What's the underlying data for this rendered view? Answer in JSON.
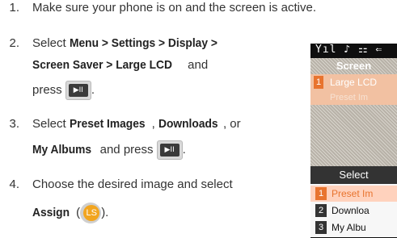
{
  "steps": [
    {
      "num": "1.",
      "text": "Make sure your phone is on and the screen is active."
    },
    {
      "num": "2.",
      "pre": "Select ",
      "path": "Menu > Settings > Display >",
      "path2": "Screen Saver > Large LCD",
      "post": " and",
      "press": "press"
    },
    {
      "num": "3.",
      "pre": "Select ",
      "a": "Preset Images",
      "sep1": ", ",
      "b": "Downloads",
      "sep2": ", or",
      "c": "My Albums",
      "post": " and press"
    },
    {
      "num": "4.",
      "text": "Choose the desired image and select",
      "assign": "Assign",
      "open": " (",
      "close": ")."
    }
  ],
  "key_label": "▶II",
  "ls_label": "LS",
  "phone": {
    "status": "Yıl ♪ ⚏ ⇐",
    "header": "Screen",
    "row1_index": "1",
    "row1_label": "Large LCD",
    "row2_label": "Preset Im",
    "popup_title": "Select",
    "options": [
      {
        "n": "1",
        "label": "Preset Im",
        "selected": true
      },
      {
        "n": "2",
        "label": "Downloa",
        "selected": false
      },
      {
        "n": "3",
        "label": "My Albu",
        "selected": false
      }
    ]
  }
}
